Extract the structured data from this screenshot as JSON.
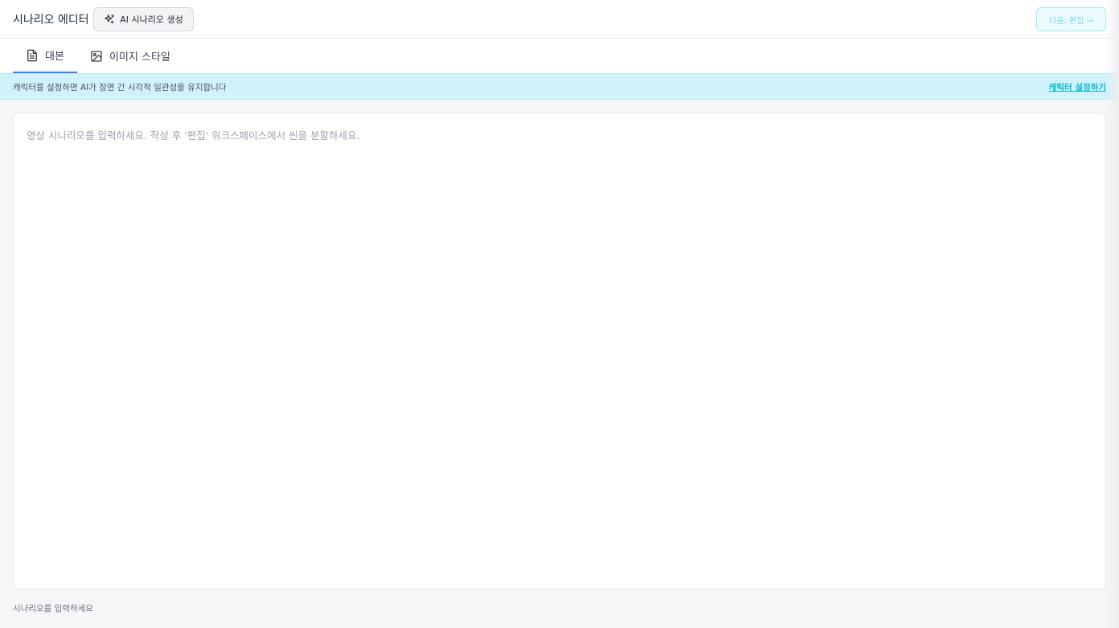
{
  "header": {
    "title": "시나리오 에디터",
    "ai_button_label": "AI 시나리오 생성",
    "ai_button_icon": "sparkles-icon",
    "next_button_label": "다음: 편집 →"
  },
  "tabs": [
    {
      "label": "대본",
      "icon": "document-icon",
      "active": true
    },
    {
      "label": "이미지 스타일",
      "icon": "image-icon",
      "active": false
    }
  ],
  "banner": {
    "text": "캐릭터를 설정하면 AI가 장면 간 시각적 일관성을 유지합니다",
    "link_label": "캐릭터 설정하기"
  },
  "editor": {
    "value": "",
    "placeholder": "영상 시나리오를 입력하세요. 작성 후 '편집' 워크스페이스에서 씬을 분할하세요."
  },
  "footer": {
    "hint": "시나리오를 입력하세요"
  },
  "colors": {
    "accent": "#3b82f6",
    "banner_bg": "#d2f2fb",
    "link": "#06b6d4"
  }
}
